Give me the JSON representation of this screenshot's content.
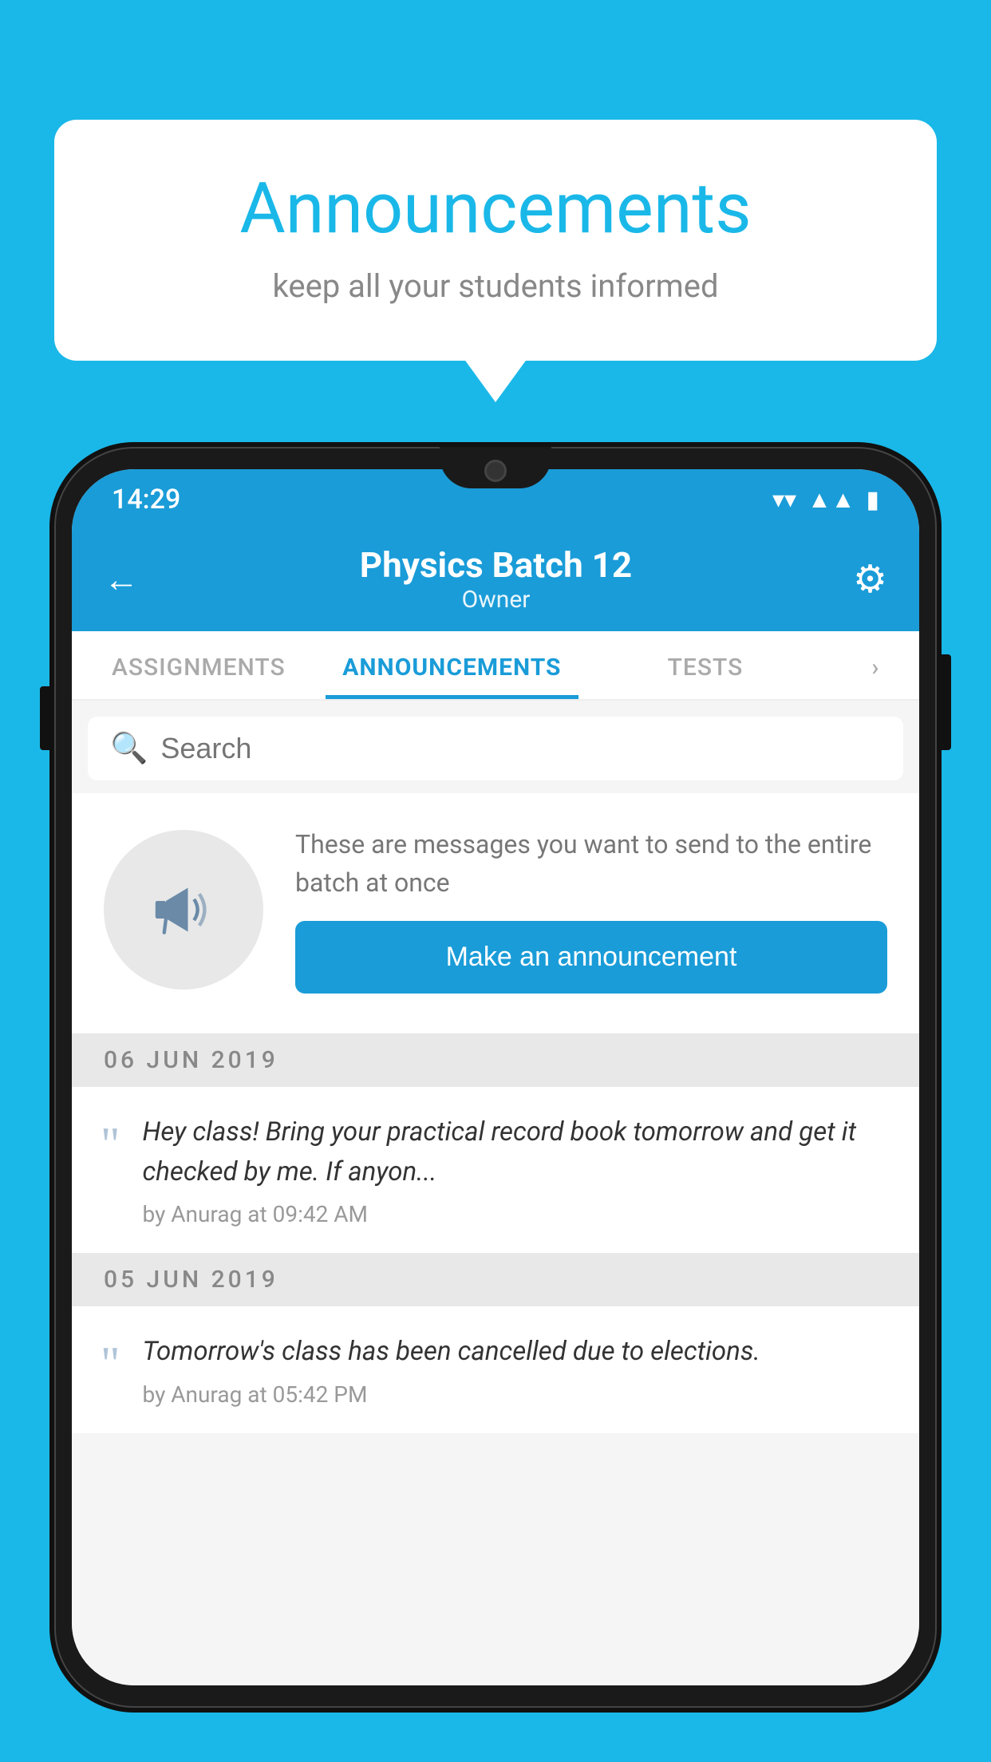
{
  "page": {
    "background_color": "#1ab8e8"
  },
  "speech_bubble": {
    "title": "Announcements",
    "subtitle": "keep all your students informed"
  },
  "status_bar": {
    "time": "14:29",
    "wifi_icon": "▼",
    "signal_icon": "▲",
    "battery_icon": "▮"
  },
  "app_header": {
    "back_icon": "←",
    "title": "Physics Batch 12",
    "subtitle": "Owner",
    "gear_icon": "⚙"
  },
  "tabs": [
    {
      "label": "ASSIGNMENTS",
      "active": false
    },
    {
      "label": "ANNOUNCEMENTS",
      "active": true
    },
    {
      "label": "TESTS",
      "active": false
    },
    {
      "label": "›",
      "active": false
    }
  ],
  "search": {
    "placeholder": "Search",
    "icon": "🔍"
  },
  "announcement_prompt": {
    "description": "These are messages you want to send to the entire batch at once",
    "button_label": "Make an announcement"
  },
  "date_sections": [
    {
      "date": "06  JUN  2019",
      "items": [
        {
          "text": "Hey class! Bring your practical record book tomorrow and get it checked by me. If anyon...",
          "meta": "by Anurag at 09:42 AM"
        }
      ]
    },
    {
      "date": "05  JUN  2019",
      "items": [
        {
          "text": "Tomorrow's class has been cancelled due to elections.",
          "meta": "by Anurag at 05:42 PM"
        }
      ]
    }
  ]
}
